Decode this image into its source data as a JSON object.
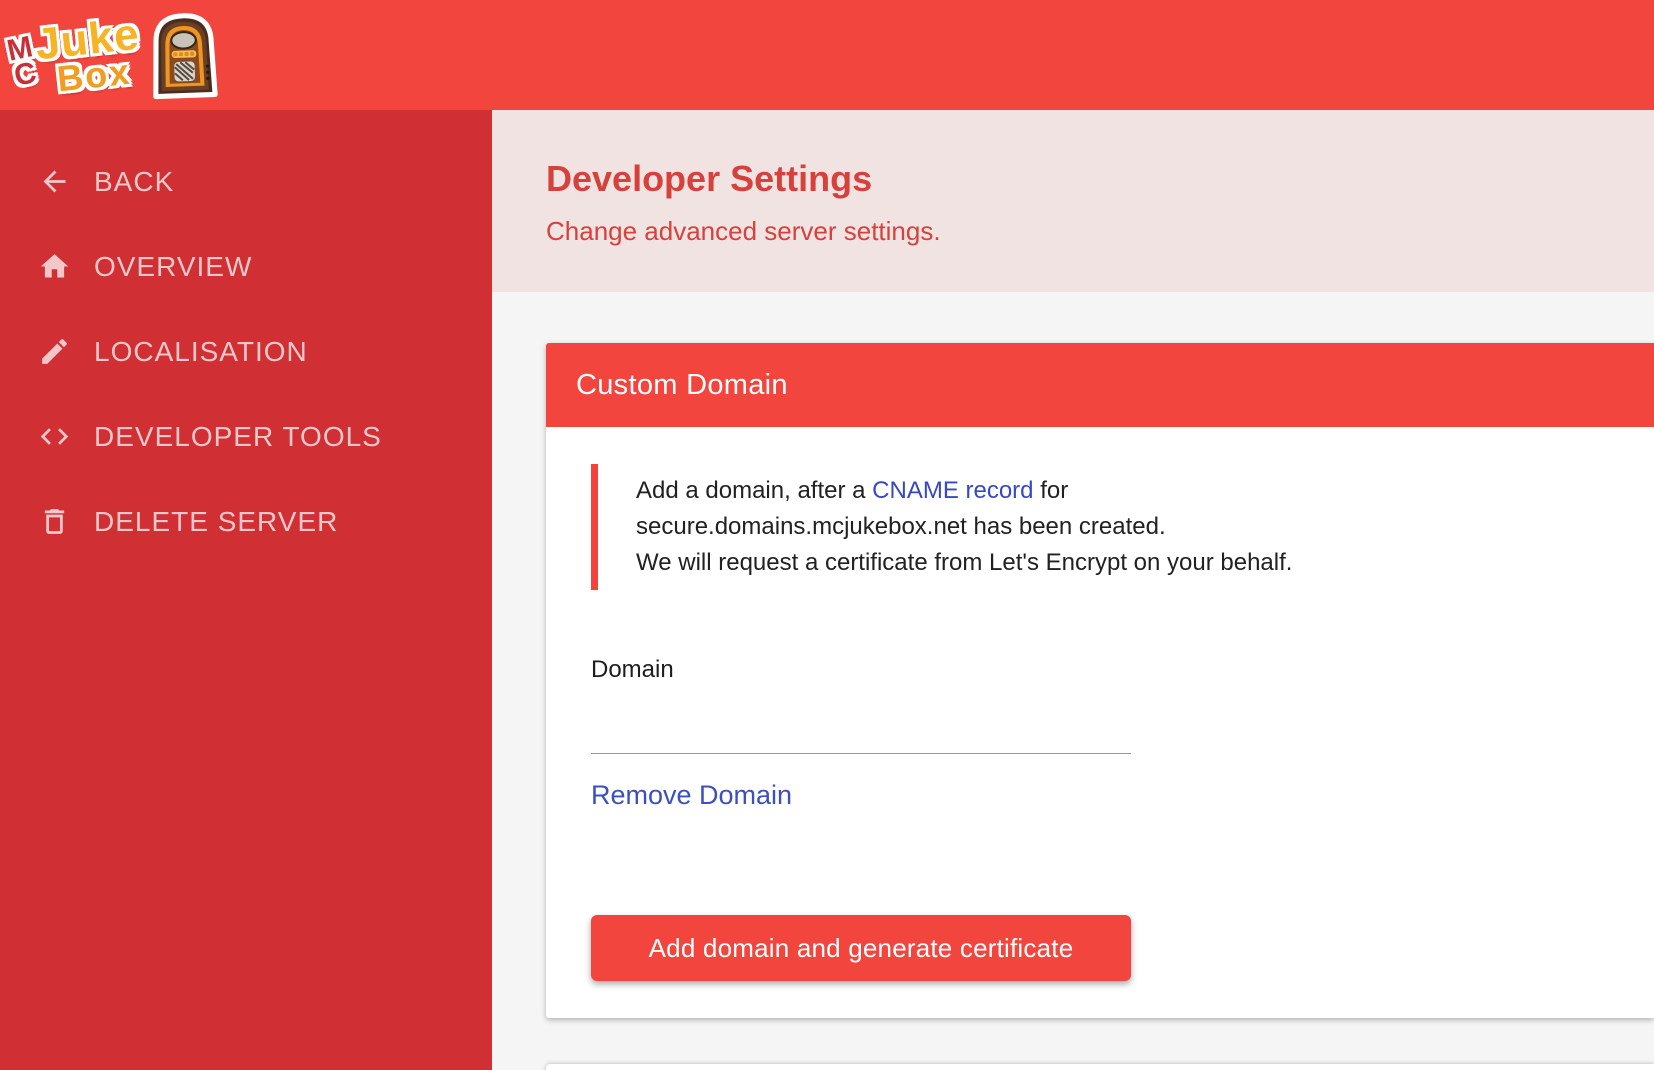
{
  "app": {
    "logo": {
      "mc": "MC",
      "juke": "Juke",
      "box": "Box"
    }
  },
  "colors": {
    "topbar_red": "#f2453d",
    "sidebar_red": "#d02f33",
    "header_band_pink": "#f2e3e3",
    "title_red": "#d6413c",
    "link_blue": "#3848c3",
    "remove_link_blue": "#3c50bd",
    "alert_bar_red": "#f4433a",
    "sidebar_text_pink": "#f1c7ca",
    "content_bg": "#f5f5f5"
  },
  "sidebar": {
    "items": [
      {
        "label": "BACK",
        "icon": "arrow-left-icon",
        "slug": "back"
      },
      {
        "label": "OVERVIEW",
        "icon": "home-icon",
        "slug": "overview"
      },
      {
        "label": "LOCALISATION",
        "icon": "pencil-icon",
        "slug": "localisation"
      },
      {
        "label": "DEVELOPER TOOLS",
        "icon": "code-icon",
        "slug": "developer-tools"
      },
      {
        "label": "DELETE SERVER",
        "icon": "trash-icon",
        "slug": "delete-server"
      }
    ]
  },
  "header": {
    "title": "Developer Settings",
    "subtitle": "Change advanced server settings."
  },
  "card": {
    "title": "Custom Domain",
    "alert": {
      "line1_before": "Add a domain, after a ",
      "line1_link": "CNAME record",
      "line1_after": " for",
      "line2": "secure.domains.mcjukebox.net has been created.",
      "line3": "We will request a certificate from Let's Encrypt on your behalf."
    },
    "form": {
      "domain_label": "Domain",
      "domain_value": "",
      "remove_link": "Remove Domain",
      "submit_label": "Add domain and generate certificate"
    }
  }
}
